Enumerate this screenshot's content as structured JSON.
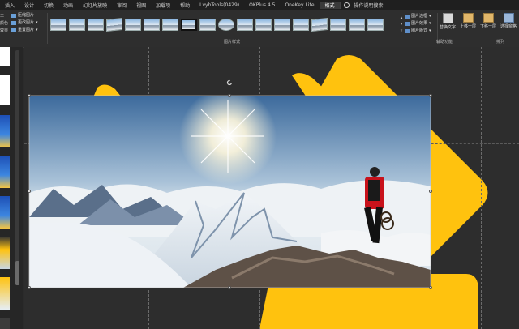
{
  "menu": {
    "tabs": [
      "插入",
      "设计",
      "切换",
      "动画",
      "幻灯片放映",
      "审阅",
      "视图",
      "加载项",
      "帮助",
      "LvyhTools(0429)",
      "OKPlus 4.5",
      "OneKey Lite",
      "格式"
    ],
    "active_tab": "格式",
    "tell_me": "操作说明搜索"
  },
  "ribbon": {
    "left_partial": [
      "工",
      "颜色",
      "效果"
    ],
    "adjust": {
      "compress": "压缩图片",
      "change": "更改图片",
      "reset": "重置图片"
    },
    "picture_styles_label": "图片样式",
    "picture_options": {
      "border": "图片边框",
      "effects": "图片效果",
      "layout": "图片版式"
    },
    "accessibility": {
      "alt_text": "替换文字",
      "group_label": "辅助功能"
    },
    "arrange": {
      "bring_forward": "上移一层",
      "send_backward": "下移一层",
      "selection_pane": "选择窗格",
      "group_label": "排列"
    }
  },
  "colors": {
    "accent_yellow": "#FFC20E",
    "ribbon_bg": "#2E2E2E",
    "canvas_bg": "#2D2D2D"
  }
}
